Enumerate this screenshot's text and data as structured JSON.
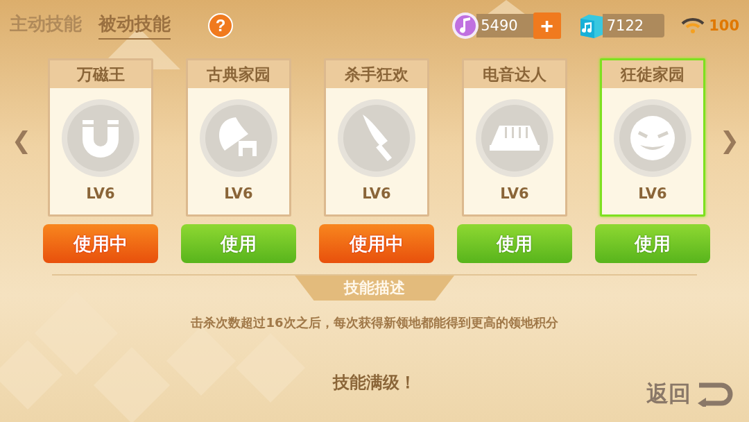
{
  "tabs": [
    {
      "label": "主动技能",
      "selected": false
    },
    {
      "label": "被动技能",
      "selected": true
    }
  ],
  "help": "?",
  "currencies": [
    {
      "kind": "note",
      "amount": "5490",
      "add": "+"
    },
    {
      "kind": "cube",
      "amount": "7122"
    }
  ],
  "signal": "100",
  "nav": {
    "prev": "❮",
    "next": "❯"
  },
  "skills": [
    {
      "name": "万磁王",
      "kind": "magnet",
      "level": "LV6",
      "selected": false,
      "in_use": true,
      "button": "使用中"
    },
    {
      "name": "古典家园",
      "kind": "gramophone",
      "level": "LV6",
      "selected": false,
      "in_use": false,
      "button": "使用"
    },
    {
      "name": "杀手狂欢",
      "kind": "knife",
      "level": "LV6",
      "selected": false,
      "in_use": true,
      "button": "使用中"
    },
    {
      "name": "电音达人",
      "kind": "keyboard",
      "level": "LV6",
      "selected": false,
      "in_use": false,
      "button": "使用"
    },
    {
      "name": "狂徒家园",
      "kind": "face",
      "level": "LV6",
      "selected": true,
      "in_use": false,
      "button": "使用"
    }
  ],
  "description": {
    "title": "技能描述",
    "text": "击杀次数超过16次之后，每次获得新领地都能得到更高的领地积分",
    "status": "技能满级！"
  },
  "back": "返回"
}
